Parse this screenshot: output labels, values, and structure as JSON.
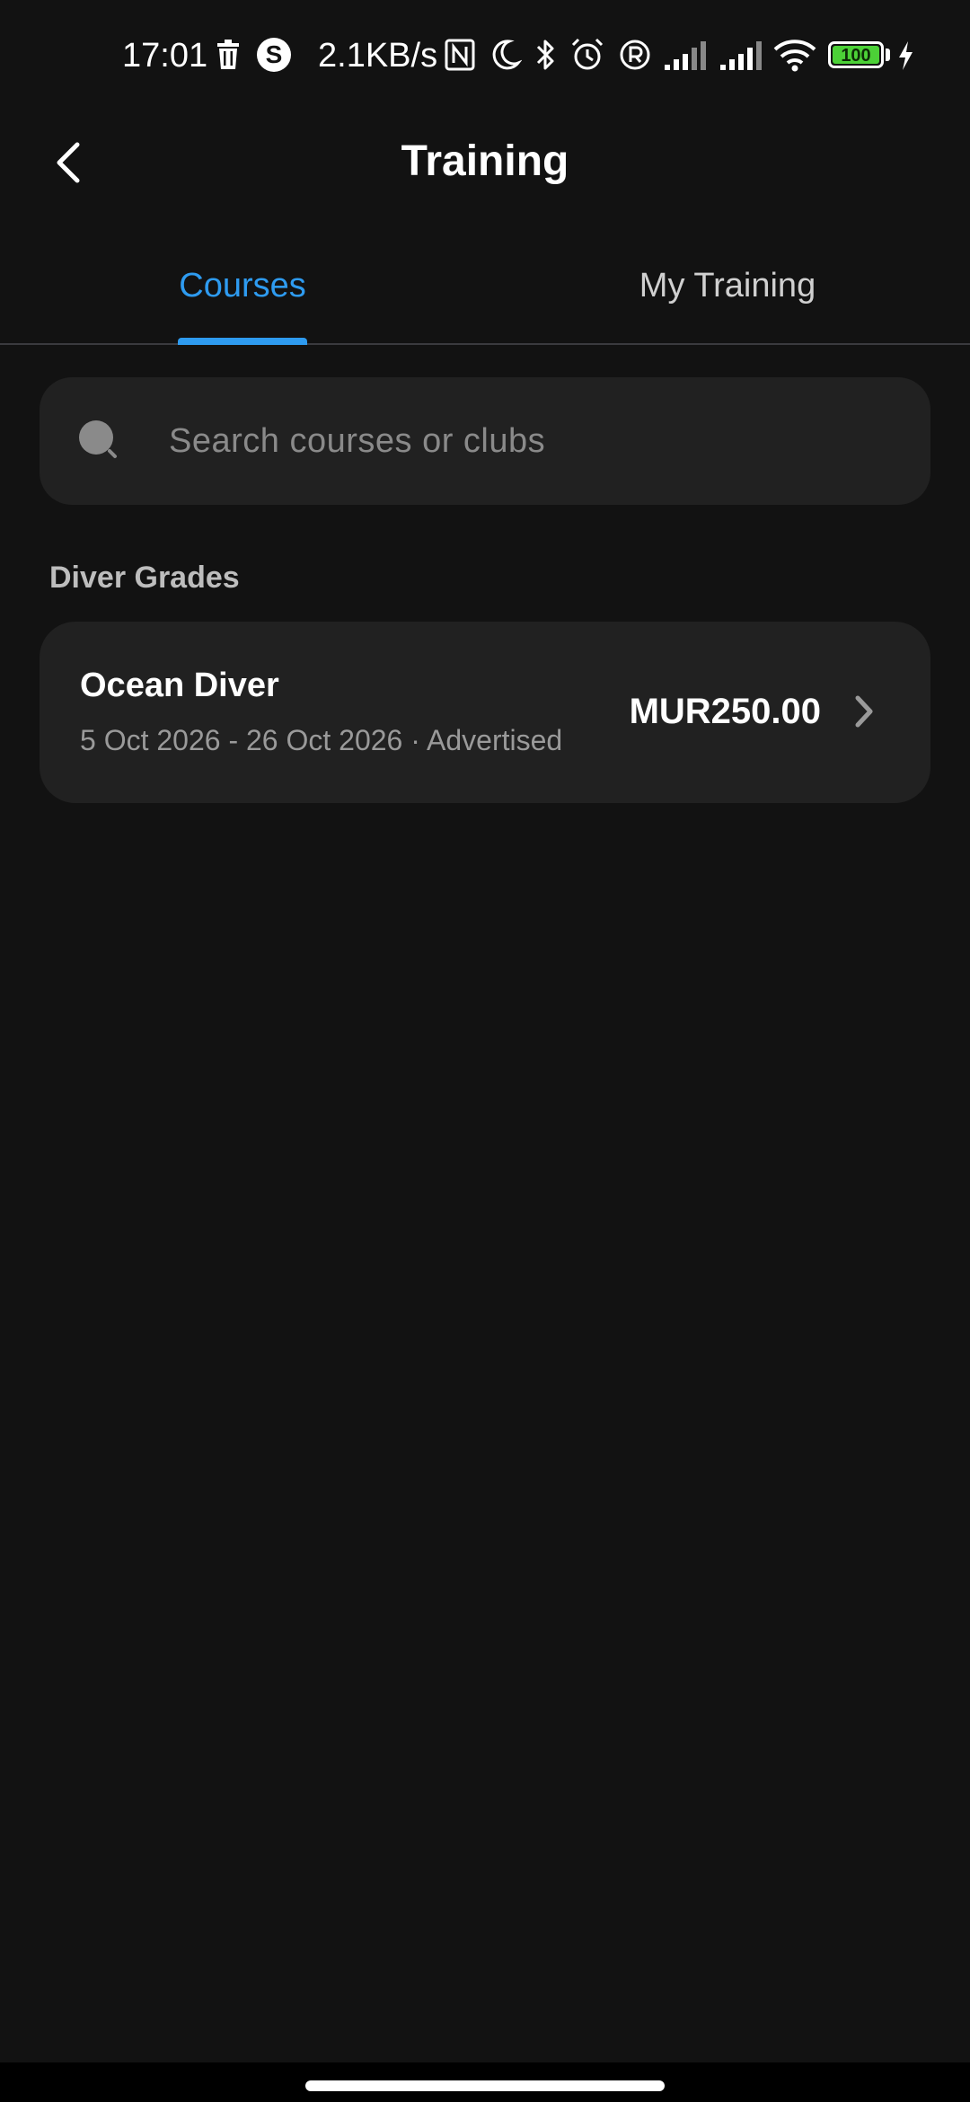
{
  "status_bar": {
    "time": "17:01",
    "network_speed": "2.1KB/s",
    "battery_level": "100",
    "icons": [
      "trash-icon",
      "s-app-icon",
      "nfc-icon",
      "moon-icon",
      "bluetooth-icon",
      "alarm-icon",
      "registered-icon",
      "signal-icon",
      "signal-icon",
      "wifi-icon",
      "battery-icon",
      "charging-icon"
    ]
  },
  "header": {
    "title": "Training",
    "back_icon": "chevron-left-icon"
  },
  "tabs": [
    {
      "label": "Courses",
      "active": true
    },
    {
      "label": "My Training",
      "active": false
    }
  ],
  "search": {
    "placeholder": "Search courses or clubs",
    "icon": "search-icon"
  },
  "sections": [
    {
      "heading": "Diver Grades",
      "courses": [
        {
          "name": "Ocean Diver",
          "meta": "5 Oct 2026 - 26 Oct 2026 · Advertised",
          "price": "MUR250.00"
        }
      ]
    }
  ],
  "colors": {
    "background": "#121212",
    "surface": "#212121",
    "accent": "#2e9bf0",
    "battery": "#4cd137"
  }
}
